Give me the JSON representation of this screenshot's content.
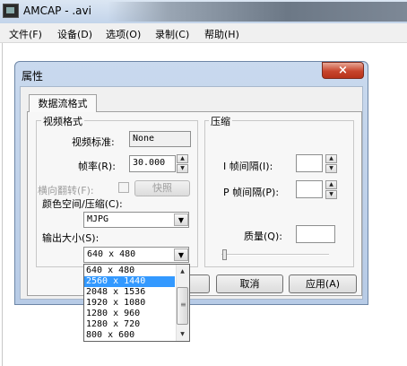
{
  "app": {
    "title": "AMCAP - .avi",
    "menu": [
      "文件(F)",
      "设备(D)",
      "选项(O)",
      "录制(C)",
      "帮助(H)"
    ]
  },
  "dialog": {
    "title": "属性",
    "tab_label": "数据流格式",
    "video_group": {
      "label": "视频格式",
      "standard_label": "视频标准:",
      "standard_value": "None",
      "framerate_label": "帧率(R):",
      "framerate_value": "30.000",
      "flip_label": "横向翻转(F):",
      "snapshot_label": "快照",
      "colorspace_label": "颜色空间/压缩(C):",
      "colorspace_value": "MJPG",
      "outputsize_label": "输出大小(S):",
      "outputsize_value": "640 x 480"
    },
    "compress_group": {
      "label": "压缩",
      "i_frame_label": "I 帧间隔(I):",
      "p_frame_label": "P 帧间隔(P):",
      "quality_label": "质量(Q):",
      "quality_level": 0
    },
    "buttons": {
      "cancel": "取消",
      "apply": "应用(A)"
    },
    "size_options": [
      "640 x 480",
      "2560 x 1440",
      "2048 x 1536",
      "1920 x 1080",
      "1280 x 960",
      "1280 x 720",
      "800 x 600"
    ],
    "selected_size": "2560 x 1440",
    "close_glyph": "×"
  },
  "icons": [
    "app-icon",
    "close-icon",
    "spin-up-icon",
    "spin-down-icon",
    "chevron-down-icon",
    "scroll-up-icon",
    "scroll-down-icon"
  ]
}
